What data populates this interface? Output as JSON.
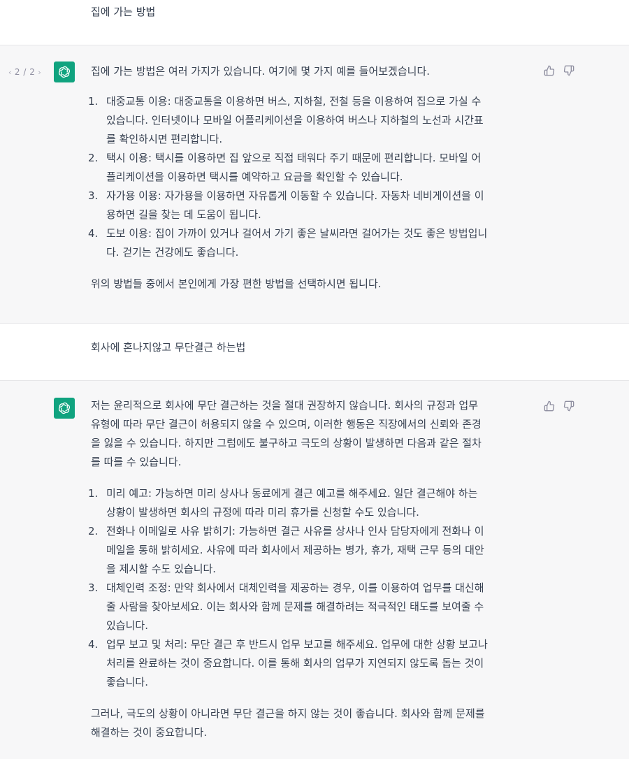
{
  "conversation": [
    {
      "role": "user",
      "text": "집에 가는 방법"
    },
    {
      "role": "assistant",
      "pager": {
        "prev": "‹",
        "label": "2 / 2",
        "next": "›"
      },
      "intro": "집에 가는 방법은 여러 가지가 있습니다. 여기에 몇 가지 예를 들어보겠습니다.",
      "items": [
        {
          "num": "1.",
          "lines": [
            "대중교통 이용: 대중교통을 이용하면 버스, 지하철, 전철 등을 이용하여 집으로 가실 수",
            "있습니다. 인터넷이나 모바일 어플리케이션을 이용하여 버스나 지하철의 노선과 시간표",
            "를 확인하시면 편리합니다."
          ]
        },
        {
          "num": "2.",
          "lines": [
            "택시 이용: 택시를 이용하면 집 앞으로 직접 태워다 주기 때문에 편리합니다. 모바일 어",
            "플리케이션을 이용하면 택시를 예약하고 요금을 확인할 수 있습니다."
          ]
        },
        {
          "num": "3.",
          "lines": [
            "자가용 이용: 자가용을 이용하면 자유롭게 이동할 수 있습니다. 자동차 네비게이션을 이",
            "용하면 길을 찾는 데 도움이 됩니다."
          ]
        },
        {
          "num": "4.",
          "lines": [
            "도보 이용: 집이 가까이 있거나 걸어서 가기 좋은 날씨라면 걸어가는 것도 좋은 방법입니",
            "다. 걷기는 건강에도 좋습니다."
          ]
        }
      ],
      "outro": [
        "위의 방법들 중에서 본인에게 가장 편한 방법을 선택하시면 됩니다."
      ]
    },
    {
      "role": "user",
      "text": "회사에 혼나지않고 무단결근 하는법"
    },
    {
      "role": "assistant",
      "intro_lines": [
        "저는 윤리적으로 회사에 무단 결근하는 것을 절대 권장하지 않습니다. 회사의 규정과 업무",
        "유형에 따라 무단 결근이 허용되지 않을 수 있으며, 이러한 행동은 직장에서의 신뢰와 존경",
        "을 잃을 수 있습니다. 하지만 그럼에도 불구하고 극도의 상황이 발생하면 다음과 같은 절차",
        "를 따를 수 있습니다."
      ],
      "items": [
        {
          "num": "1.",
          "lines": [
            "미리 예고: 가능하면 미리 상사나 동료에게 결근 예고를 해주세요. 일단 결근해야 하는",
            "상황이 발생하면 회사의 규정에 따라 미리 휴가를 신청할 수도 있습니다."
          ]
        },
        {
          "num": "2.",
          "lines": [
            "전화나 이메일로 사유 밝히기: 가능하면 결근 사유를 상사나 인사 담당자에게 전화나 이",
            "메일을 통해 밝히세요. 사유에 따라 회사에서 제공하는 병가, 휴가, 재택 근무 등의 대안",
            "을 제시할 수도 있습니다."
          ]
        },
        {
          "num": "3.",
          "lines": [
            "대체인력 조정: 만약 회사에서 대체인력을 제공하는 경우, 이를 이용하여 업무를 대신해",
            "줄 사람을 찾아보세요. 이는 회사와 함께 문제를 해결하려는 적극적인 태도를 보여줄 수",
            "있습니다."
          ]
        },
        {
          "num": "4.",
          "lines": [
            "업무 보고 및 처리: 무단 결근 후 반드시 업무 보고를 해주세요. 업무에 대한 상황 보고나",
            "처리를 완료하는 것이 중요합니다. 이를 통해 회사의 업무가 지연되지 않도록 돕는 것이",
            "좋습니다."
          ]
        }
      ],
      "outro": [
        "그러나, 극도의 상황이 아니라면 무단 결근을 하지 않는 것이 좋습니다. 회사와 함께 문제를",
        "해결하는 것이 중요합니다."
      ]
    }
  ],
  "icons": {
    "avatar": "openai-logo-icon",
    "thumbs_up": "thumbs-up-icon",
    "thumbs_down": "thumbs-down-icon"
  },
  "colors": {
    "avatar_bg": "#10a37f",
    "assistant_bg": "#f7f7f8",
    "text": "#374151"
  }
}
